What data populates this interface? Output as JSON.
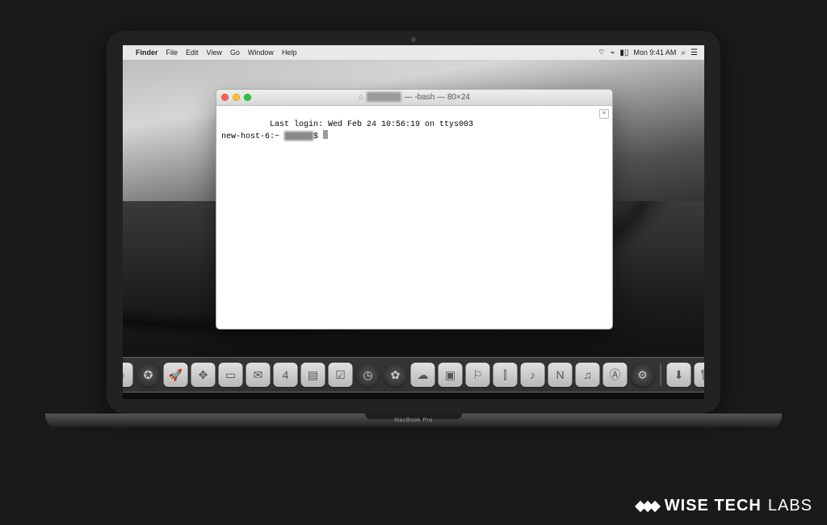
{
  "menubar": {
    "app_name": "Finder",
    "items": [
      "File",
      "Edit",
      "View",
      "Go",
      "Window",
      "Help"
    ],
    "clock": "Mon 9:41 AM",
    "status_icons": [
      "wifi",
      "bluetooth",
      "battery"
    ],
    "right_icons": [
      "search",
      "control-center"
    ]
  },
  "terminal": {
    "title_home_icon": "⌂",
    "title_user_blurred": "██████",
    "title_suffix": " — -bash — 80×24",
    "line1": "Last login: Wed Feb 24 10:56:19 on ttys003",
    "prompt_host": "new-host-6:~ ",
    "prompt_user_blurred": "██████",
    "prompt_suffix": "$ "
  },
  "dock": {
    "apps": [
      {
        "name": "finder",
        "glyph": "☺"
      },
      {
        "name": "safari",
        "glyph": "✪"
      },
      {
        "name": "launchpad",
        "glyph": "🚀"
      },
      {
        "name": "compass",
        "glyph": "✥"
      },
      {
        "name": "contacts",
        "glyph": "▭"
      },
      {
        "name": "mail",
        "glyph": "✉"
      },
      {
        "name": "calendar",
        "glyph": "4"
      },
      {
        "name": "notes",
        "glyph": "▤"
      },
      {
        "name": "reminders",
        "glyph": "☑"
      },
      {
        "name": "clock",
        "glyph": "◷"
      },
      {
        "name": "photos",
        "glyph": "✿"
      },
      {
        "name": "messages",
        "glyph": "☁"
      },
      {
        "name": "facetime",
        "glyph": "▣"
      },
      {
        "name": "maps",
        "glyph": "⚐"
      },
      {
        "name": "stocks",
        "glyph": "⫿"
      },
      {
        "name": "podcasts",
        "glyph": "♪"
      },
      {
        "name": "news",
        "glyph": "N"
      },
      {
        "name": "music",
        "glyph": "♫"
      },
      {
        "name": "appstore",
        "glyph": "Ⓐ"
      },
      {
        "name": "preferences",
        "glyph": "⚙"
      }
    ],
    "rightApps": [
      {
        "name": "downloads",
        "glyph": "⬇"
      },
      {
        "name": "trash",
        "glyph": "🗑"
      }
    ]
  },
  "hardware": {
    "model_label": "MacBook Pro"
  },
  "watermark": {
    "brand1": "WISE TECH",
    "brand2": "LABS"
  }
}
